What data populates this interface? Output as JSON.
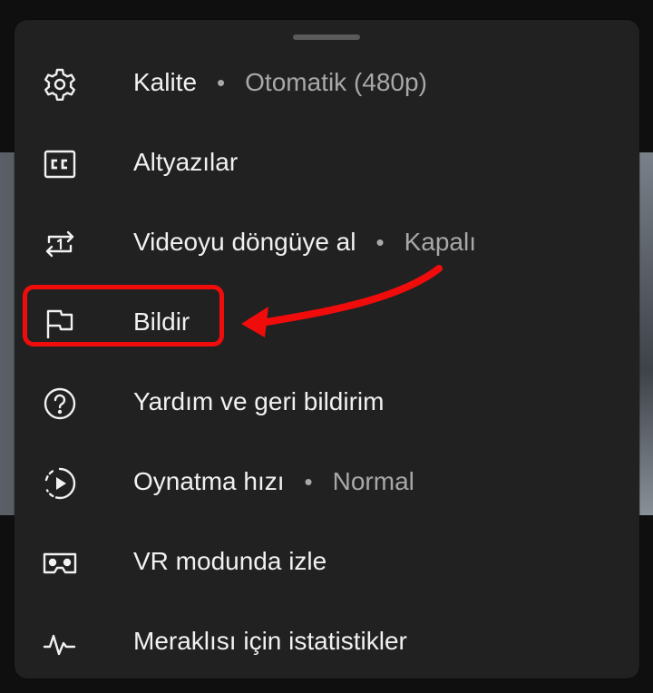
{
  "menu": {
    "items": [
      {
        "label": "Kalite",
        "value": "Otomatik (480p)",
        "icon": "gear-icon"
      },
      {
        "label": "Altyazılar",
        "value": "",
        "icon": "cc-icon"
      },
      {
        "label": "Videoyu döngüye al",
        "value": "Kapalı",
        "icon": "loop-icon"
      },
      {
        "label": "Bildir",
        "value": "",
        "icon": "flag-icon"
      },
      {
        "label": "Yardım ve geri bildirim",
        "value": "",
        "icon": "help-icon"
      },
      {
        "label": "Oynatma hızı",
        "value": "Normal",
        "icon": "playback-speed-icon"
      },
      {
        "label": "VR modunda izle",
        "value": "",
        "icon": "vr-icon"
      },
      {
        "label": "Meraklısı için istatistikler",
        "value": "",
        "icon": "stats-icon"
      }
    ],
    "separator": "•"
  },
  "colors": {
    "sheet": "#212121",
    "text": "#f1f1f1",
    "secondary": "#a8a8a8",
    "annotation": "#f10c0c"
  }
}
